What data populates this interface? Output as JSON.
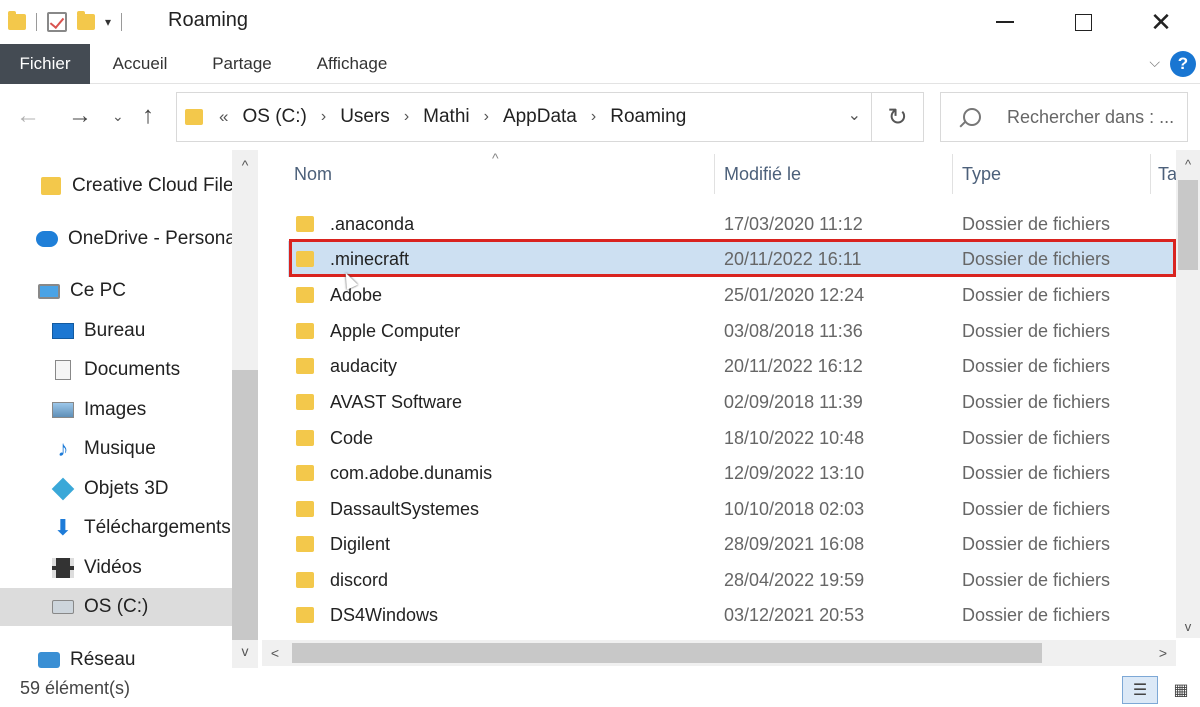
{
  "window": {
    "title": "Roaming",
    "qat_dropdown": "▾",
    "minimize": "",
    "maximize": "",
    "close": "✕"
  },
  "ribbon": {
    "tabs": [
      {
        "label": "Fichier"
      },
      {
        "label": "Accueil"
      },
      {
        "label": "Partage"
      },
      {
        "label": "Affichage"
      }
    ],
    "expand_chevron": "⌵",
    "help": "?"
  },
  "navigation": {
    "back": "←",
    "forward": "→",
    "recent": "⌄",
    "up": "↑"
  },
  "address": {
    "overflow": "«",
    "crumbs": [
      "OS (C:)",
      "Users",
      "Mathi",
      "AppData",
      "Roaming"
    ],
    "separator": "›",
    "dropdown": "⌄",
    "refresh": "↻"
  },
  "search": {
    "placeholder": "Rechercher dans : ..."
  },
  "sidebar": {
    "items": [
      {
        "label": "Creative Cloud Files",
        "icon": "folder-icon"
      },
      {
        "label": "OneDrive - Personal",
        "icon": "cloud-icon"
      },
      {
        "label": "Ce PC",
        "icon": "pc-icon"
      },
      {
        "label": "Bureau",
        "icon": "desktop-icon"
      },
      {
        "label": "Documents",
        "icon": "document-icon"
      },
      {
        "label": "Images",
        "icon": "image-icon"
      },
      {
        "label": "Musique",
        "icon": "music-icon"
      },
      {
        "label": "Objets 3D",
        "icon": "cube-icon"
      },
      {
        "label": "Téléchargements",
        "icon": "download-icon"
      },
      {
        "label": "Vidéos",
        "icon": "video-icon"
      },
      {
        "label": "OS (C:)",
        "icon": "drive-icon",
        "selected": true
      },
      {
        "label": "Réseau",
        "icon": "network-icon"
      }
    ],
    "music_glyph": "♪",
    "download_glyph": "⬇"
  },
  "filelist": {
    "columns": {
      "name": "Nom",
      "modified": "Modifié le",
      "type": "Type",
      "size": "Ta"
    },
    "sort_indicator": "^",
    "rows": [
      {
        "name": ".anaconda",
        "modified": "17/03/2020 11:12",
        "type": "Dossier de fichiers"
      },
      {
        "name": ".minecraft",
        "modified": "20/11/2022 16:11",
        "type": "Dossier de fichiers",
        "selected": true
      },
      {
        "name": "Adobe",
        "modified": "25/01/2020 12:24",
        "type": "Dossier de fichiers"
      },
      {
        "name": "Apple Computer",
        "modified": "03/08/2018 11:36",
        "type": "Dossier de fichiers"
      },
      {
        "name": "audacity",
        "modified": "20/11/2022 16:12",
        "type": "Dossier de fichiers"
      },
      {
        "name": "AVAST Software",
        "modified": "02/09/2018 11:39",
        "type": "Dossier de fichiers"
      },
      {
        "name": "Code",
        "modified": "18/10/2022 10:48",
        "type": "Dossier de fichiers"
      },
      {
        "name": "com.adobe.dunamis",
        "modified": "12/09/2022 13:10",
        "type": "Dossier de fichiers"
      },
      {
        "name": "DassaultSystemes",
        "modified": "10/10/2018 02:03",
        "type": "Dossier de fichiers"
      },
      {
        "name": "Digilent",
        "modified": "28/09/2021 16:08",
        "type": "Dossier de fichiers"
      },
      {
        "name": "discord",
        "modified": "28/04/2022 19:59",
        "type": "Dossier de fichiers"
      },
      {
        "name": "DS4Windows",
        "modified": "03/12/2021 20:53",
        "type": "Dossier de fichiers"
      }
    ]
  },
  "scroll": {
    "up": "^",
    "down": "v",
    "left": "<",
    "right": ">"
  },
  "status": {
    "count": "59 élément(s)",
    "details_view_glyph": "☰",
    "tiles_view_glyph": "▦"
  }
}
